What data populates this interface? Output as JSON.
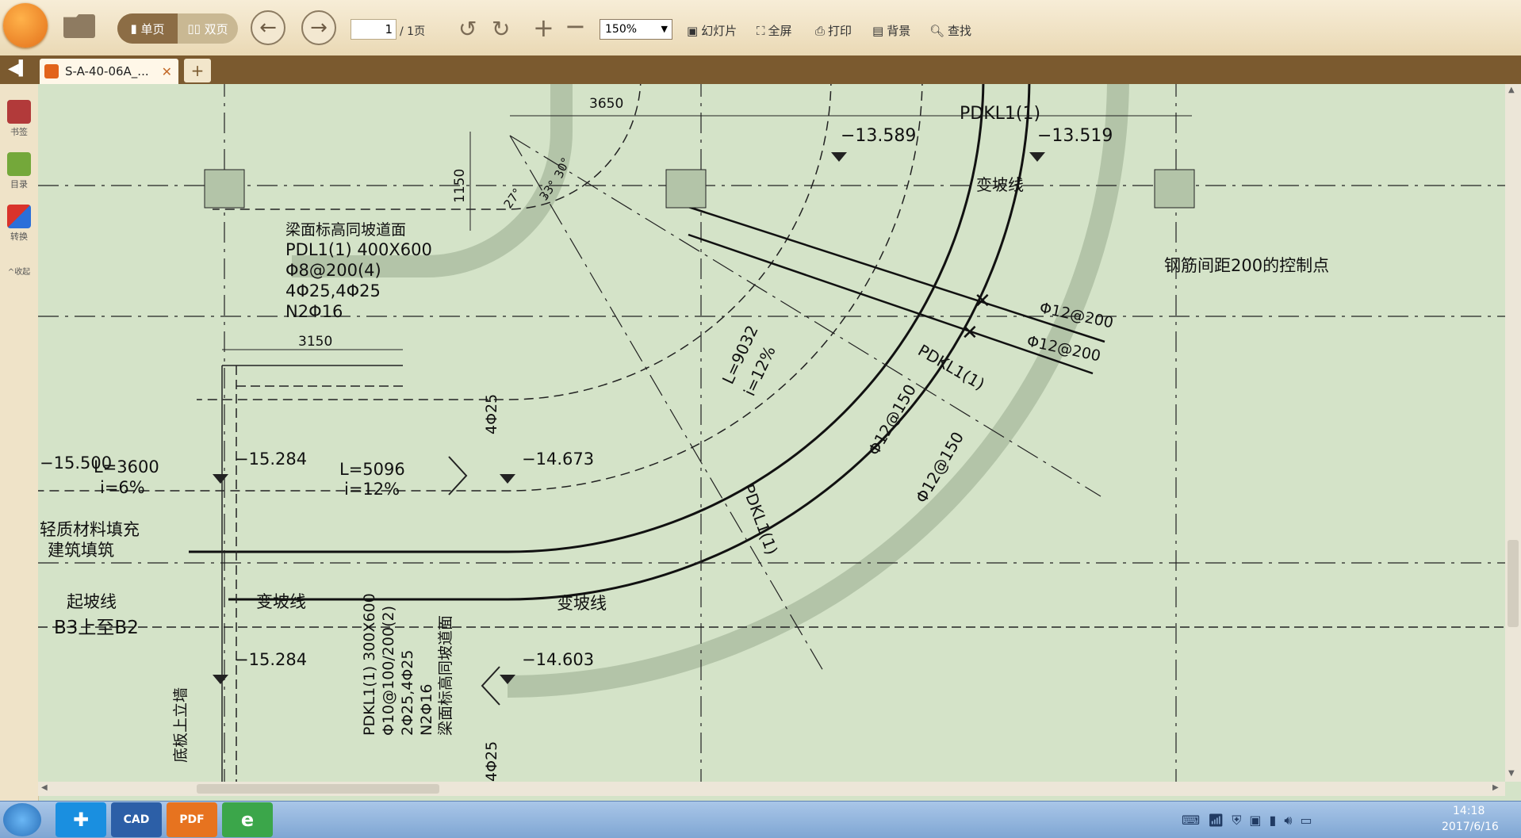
{
  "toolbar": {
    "single_page": "单页",
    "double_page": "双页",
    "page_current": "1",
    "page_total": "/ 1页",
    "zoom": "150%",
    "slideshow": "幻灯片",
    "fullscreen": "全屏",
    "print": "打印",
    "background": "背景",
    "find": "查找"
  },
  "tabs": {
    "document": "S-A-40-06A_...",
    "add": "+"
  },
  "sidebar": {
    "bookmarks": "书签",
    "toc": "目录",
    "convert": "转换",
    "collapse": "收起"
  },
  "drawing": {
    "dim_3650": "3650",
    "dim_1150": "1150",
    "dim_3150": "3150",
    "angle_27": "27°",
    "angle_33": "33°",
    "angle_30": "30°",
    "el_13589": "−13.589",
    "el_13519": "−13.519",
    "pdkl_top": "PDKL1(1)",
    "change_slope_top": "变坡线",
    "beam_note_1": "梁面标高同坡道面",
    "beam_note_2": "PDL1(1) 400X600",
    "beam_note_3": "Φ8@200(4)",
    "beam_note_4": "4Φ25,4Φ25",
    "beam_note_5": "N2Φ16",
    "rebar_control": "钢筋间距200的控制点",
    "rebar_a": "Φ12@200",
    "rebar_b": "Φ12@200",
    "pdkl_mid": "PDKL1(1)",
    "len_9032": "L=9032",
    "slope_12_diag": "i=12%",
    "rebar_150_a": "Φ12@150",
    "rebar_150_b": "Φ12@150",
    "el_15500": "−15.500",
    "len_3600": "L=3600",
    "slope_6": "i=6%",
    "el_15284_a": "−15.284",
    "len_5096": "L=5096",
    "slope_12": "i=12%",
    "el_14673": "−14.673",
    "rebar_4_25_top": "4Φ25",
    "pdkl_lower": "PDKL1(1)",
    "fill_1": "轻质材料填充",
    "fill_2": "建筑填筑",
    "start_slope": "起坡线",
    "b3_b2": "B3上至B2",
    "change_slope_left": "变坡线",
    "change_slope_right": "变坡线",
    "el_15284_b": "−15.284",
    "el_14603": "−14.603",
    "beam2_1": "PDKL1(1) 300X600",
    "beam2_2": "Φ10@100/200(2)",
    "beam2_3": "2Φ25,4Φ25",
    "beam2_4": "N2Φ16",
    "beam2_5": "梁面标高同坡道面",
    "wall_note": "底板上立墙",
    "rebar_4_25_bottom": "4Φ25"
  },
  "taskbar": {
    "time": "14:18",
    "date": "2017/6/16",
    "cad_label": "CAD",
    "pdf_label": "PDF"
  }
}
